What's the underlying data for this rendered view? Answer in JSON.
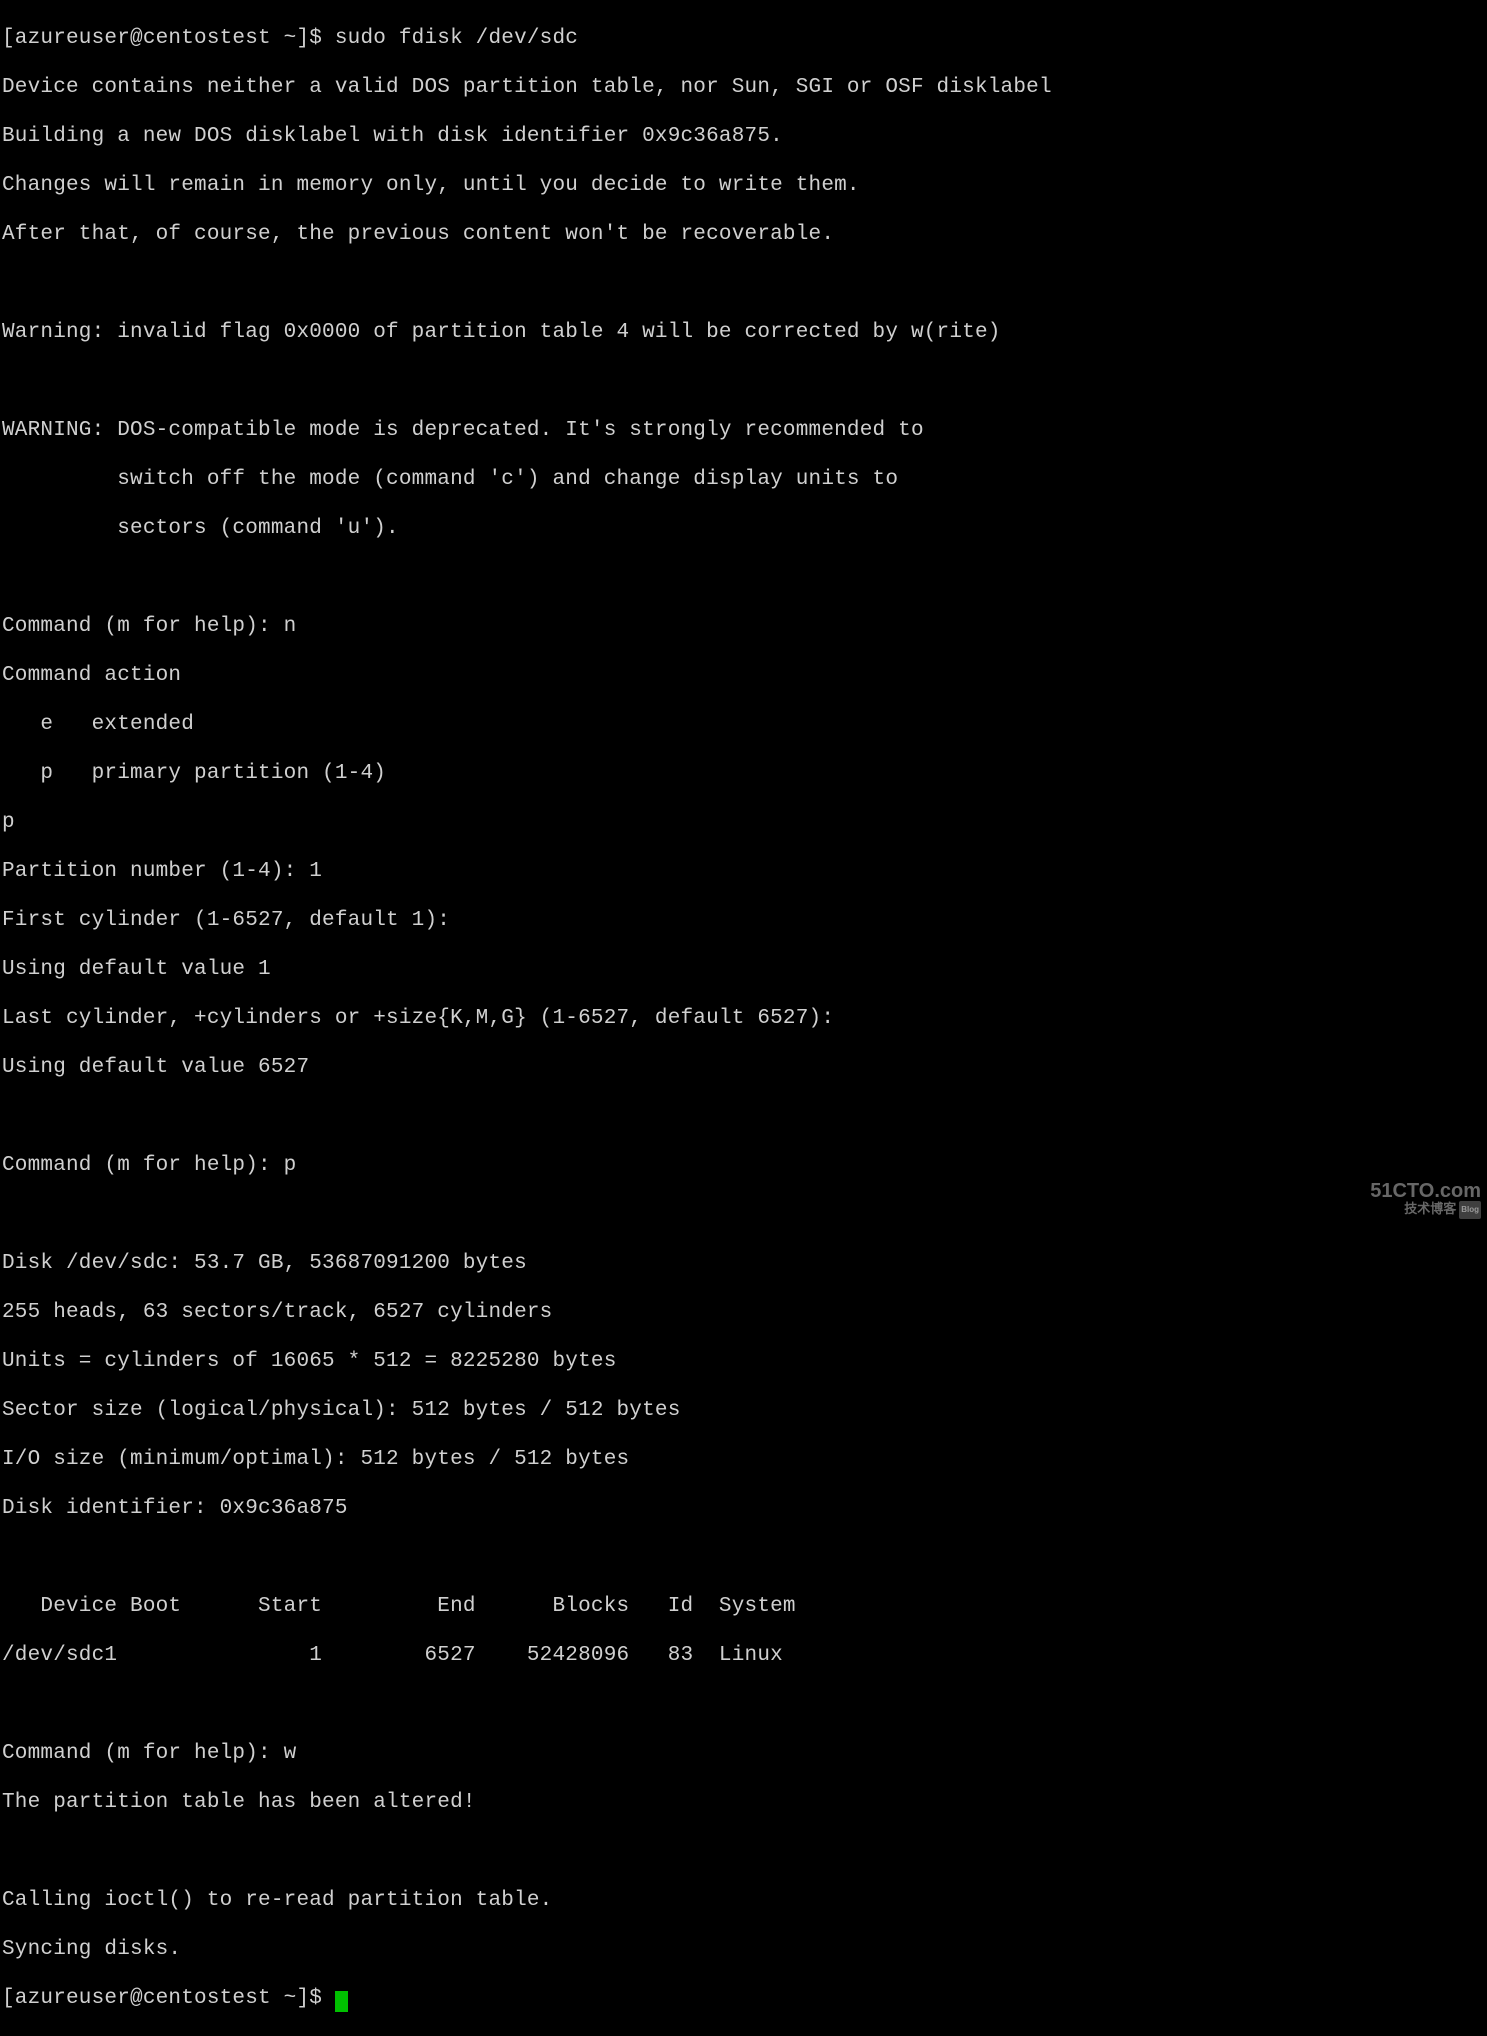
{
  "lines": {
    "l0": "[azureuser@centostest ~]$ sudo fdisk /dev/sdc",
    "l1": "Device contains neither a valid DOS partition table, nor Sun, SGI or OSF disklabel",
    "l2": "Building a new DOS disklabel with disk identifier 0x9c36a875.",
    "l3": "Changes will remain in memory only, until you decide to write them.",
    "l4": "After that, of course, the previous content won't be recoverable.",
    "l5": " ",
    "l6": "Warning: invalid flag 0x0000 of partition table 4 will be corrected by w(rite)",
    "l7": " ",
    "l8": "WARNING: DOS-compatible mode is deprecated. It's strongly recommended to",
    "l9": "         switch off the mode (command 'c') and change display units to",
    "l10": "         sectors (command 'u').",
    "l11": " ",
    "l12": "Command (m for help): n",
    "l13": "Command action",
    "l14": "   e   extended",
    "l15": "   p   primary partition (1-4)",
    "l16": "p",
    "l17": "Partition number (1-4): 1",
    "l18": "First cylinder (1-6527, default 1):",
    "l19": "Using default value 1",
    "l20": "Last cylinder, +cylinders or +size{K,M,G} (1-6527, default 6527):",
    "l21": "Using default value 6527",
    "l22": " ",
    "l23": "Command (m for help): p",
    "l24": " ",
    "l25": "Disk /dev/sdc: 53.7 GB, 53687091200 bytes",
    "l26": "255 heads, 63 sectors/track, 6527 cylinders",
    "l27": "Units = cylinders of 16065 * 512 = 8225280 bytes",
    "l28": "Sector size (logical/physical): 512 bytes / 512 bytes",
    "l29": "I/O size (minimum/optimal): 512 bytes / 512 bytes",
    "l30": "Disk identifier: 0x9c36a875",
    "l31": " ",
    "l32": "   Device Boot      Start         End      Blocks   Id  System",
    "l33": "/dev/sdc1               1        6527    52428096   83  Linux",
    "l34": " ",
    "l35": "Command (m for help): w",
    "l36": "The partition table has been altered!",
    "l37": " ",
    "l38": "Calling ioctl() to re-read partition table.",
    "l39": "Syncing disks.",
    "l40": "[azureuser@centostest ~]$ "
  },
  "watermark": {
    "top": "51CTO.com",
    "bottom": "技术博客",
    "badge": "Blog"
  }
}
